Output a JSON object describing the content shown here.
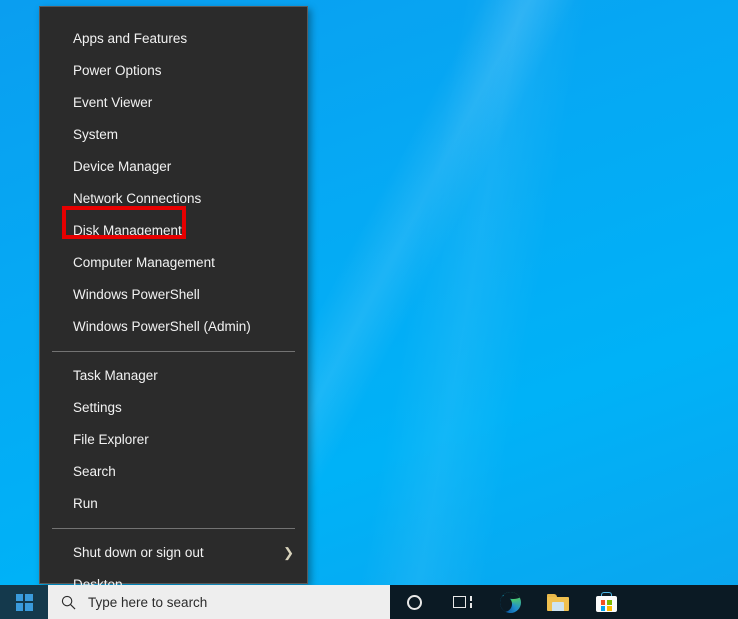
{
  "desktop": {
    "wallpaper_color": "#05aaf4",
    "wallpaper_name": "windows-10-hero-blue"
  },
  "winx_menu": {
    "groups": [
      {
        "name": "system-tools",
        "items": [
          {
            "label": "Apps and Features",
            "submenu": false
          },
          {
            "label": "Power Options",
            "submenu": false
          },
          {
            "label": "Event Viewer",
            "submenu": false
          },
          {
            "label": "System",
            "submenu": false
          },
          {
            "label": "Device Manager",
            "submenu": false
          },
          {
            "label": "Network Connections",
            "submenu": false
          },
          {
            "label": "Disk Management",
            "submenu": false,
            "highlighted": true
          },
          {
            "label": "Computer Management",
            "submenu": false
          },
          {
            "label": "Windows PowerShell",
            "submenu": false
          },
          {
            "label": "Windows PowerShell (Admin)",
            "submenu": false
          }
        ]
      },
      {
        "name": "apps",
        "items": [
          {
            "label": "Task Manager",
            "submenu": false
          },
          {
            "label": "Settings",
            "submenu": false
          },
          {
            "label": "File Explorer",
            "submenu": false
          },
          {
            "label": "Search",
            "submenu": false
          },
          {
            "label": "Run",
            "submenu": false
          }
        ]
      },
      {
        "name": "session",
        "items": [
          {
            "label": "Shut down or sign out",
            "submenu": true,
            "submenu_glyph": "❯"
          },
          {
            "label": "Desktop",
            "submenu": false
          }
        ]
      }
    ]
  },
  "annotation": {
    "target_label": "Disk Management",
    "highlight_color": "#e60000",
    "shape": "rectangle-outline"
  },
  "taskbar": {
    "background_color": "#0b1a24",
    "start_button": {
      "icon": "windows-logo-icon",
      "accent": "#3a9bdc"
    },
    "search": {
      "icon": "search-icon",
      "placeholder": "Type here to search",
      "value": "",
      "background_color": "#eeeeee"
    },
    "tray_items": [
      {
        "name": "cortana-icon",
        "label": "Cortana"
      },
      {
        "name": "task-view-icon",
        "label": "Task View"
      },
      {
        "name": "edge-icon",
        "label": "Microsoft Edge"
      },
      {
        "name": "file-explorer-icon",
        "label": "File Explorer"
      },
      {
        "name": "microsoft-store-icon",
        "label": "Microsoft Store"
      }
    ]
  }
}
